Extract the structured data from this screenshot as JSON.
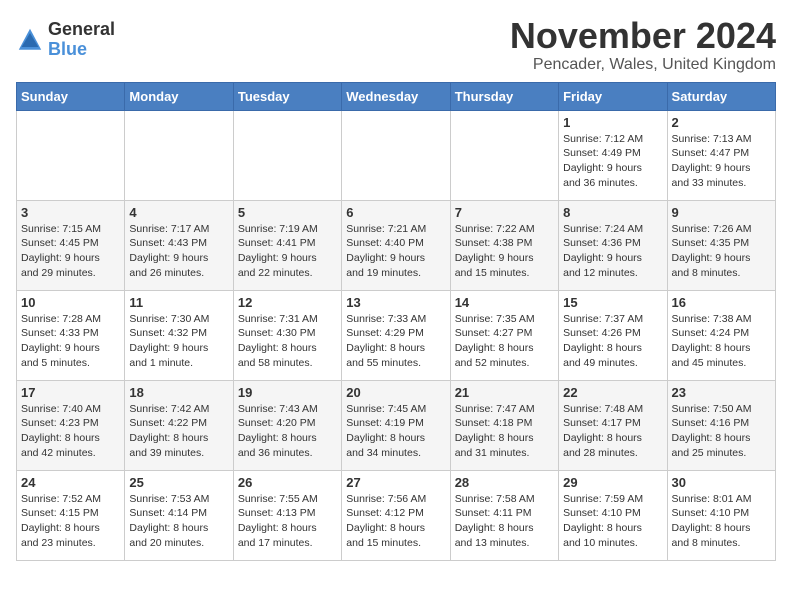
{
  "logo": {
    "general": "General",
    "blue": "Blue"
  },
  "title": "November 2024",
  "subtitle": "Pencader, Wales, United Kingdom",
  "days_of_week": [
    "Sunday",
    "Monday",
    "Tuesday",
    "Wednesday",
    "Thursday",
    "Friday",
    "Saturday"
  ],
  "weeks": [
    [
      {
        "day": "",
        "info": ""
      },
      {
        "day": "",
        "info": ""
      },
      {
        "day": "",
        "info": ""
      },
      {
        "day": "",
        "info": ""
      },
      {
        "day": "",
        "info": ""
      },
      {
        "day": "1",
        "info": "Sunrise: 7:12 AM\nSunset: 4:49 PM\nDaylight: 9 hours\nand 36 minutes."
      },
      {
        "day": "2",
        "info": "Sunrise: 7:13 AM\nSunset: 4:47 PM\nDaylight: 9 hours\nand 33 minutes."
      }
    ],
    [
      {
        "day": "3",
        "info": "Sunrise: 7:15 AM\nSunset: 4:45 PM\nDaylight: 9 hours\nand 29 minutes."
      },
      {
        "day": "4",
        "info": "Sunrise: 7:17 AM\nSunset: 4:43 PM\nDaylight: 9 hours\nand 26 minutes."
      },
      {
        "day": "5",
        "info": "Sunrise: 7:19 AM\nSunset: 4:41 PM\nDaylight: 9 hours\nand 22 minutes."
      },
      {
        "day": "6",
        "info": "Sunrise: 7:21 AM\nSunset: 4:40 PM\nDaylight: 9 hours\nand 19 minutes."
      },
      {
        "day": "7",
        "info": "Sunrise: 7:22 AM\nSunset: 4:38 PM\nDaylight: 9 hours\nand 15 minutes."
      },
      {
        "day": "8",
        "info": "Sunrise: 7:24 AM\nSunset: 4:36 PM\nDaylight: 9 hours\nand 12 minutes."
      },
      {
        "day": "9",
        "info": "Sunrise: 7:26 AM\nSunset: 4:35 PM\nDaylight: 9 hours\nand 8 minutes."
      }
    ],
    [
      {
        "day": "10",
        "info": "Sunrise: 7:28 AM\nSunset: 4:33 PM\nDaylight: 9 hours\nand 5 minutes."
      },
      {
        "day": "11",
        "info": "Sunrise: 7:30 AM\nSunset: 4:32 PM\nDaylight: 9 hours\nand 1 minute."
      },
      {
        "day": "12",
        "info": "Sunrise: 7:31 AM\nSunset: 4:30 PM\nDaylight: 8 hours\nand 58 minutes."
      },
      {
        "day": "13",
        "info": "Sunrise: 7:33 AM\nSunset: 4:29 PM\nDaylight: 8 hours\nand 55 minutes."
      },
      {
        "day": "14",
        "info": "Sunrise: 7:35 AM\nSunset: 4:27 PM\nDaylight: 8 hours\nand 52 minutes."
      },
      {
        "day": "15",
        "info": "Sunrise: 7:37 AM\nSunset: 4:26 PM\nDaylight: 8 hours\nand 49 minutes."
      },
      {
        "day": "16",
        "info": "Sunrise: 7:38 AM\nSunset: 4:24 PM\nDaylight: 8 hours\nand 45 minutes."
      }
    ],
    [
      {
        "day": "17",
        "info": "Sunrise: 7:40 AM\nSunset: 4:23 PM\nDaylight: 8 hours\nand 42 minutes."
      },
      {
        "day": "18",
        "info": "Sunrise: 7:42 AM\nSunset: 4:22 PM\nDaylight: 8 hours\nand 39 minutes."
      },
      {
        "day": "19",
        "info": "Sunrise: 7:43 AM\nSunset: 4:20 PM\nDaylight: 8 hours\nand 36 minutes."
      },
      {
        "day": "20",
        "info": "Sunrise: 7:45 AM\nSunset: 4:19 PM\nDaylight: 8 hours\nand 34 minutes."
      },
      {
        "day": "21",
        "info": "Sunrise: 7:47 AM\nSunset: 4:18 PM\nDaylight: 8 hours\nand 31 minutes."
      },
      {
        "day": "22",
        "info": "Sunrise: 7:48 AM\nSunset: 4:17 PM\nDaylight: 8 hours\nand 28 minutes."
      },
      {
        "day": "23",
        "info": "Sunrise: 7:50 AM\nSunset: 4:16 PM\nDaylight: 8 hours\nand 25 minutes."
      }
    ],
    [
      {
        "day": "24",
        "info": "Sunrise: 7:52 AM\nSunset: 4:15 PM\nDaylight: 8 hours\nand 23 minutes."
      },
      {
        "day": "25",
        "info": "Sunrise: 7:53 AM\nSunset: 4:14 PM\nDaylight: 8 hours\nand 20 minutes."
      },
      {
        "day": "26",
        "info": "Sunrise: 7:55 AM\nSunset: 4:13 PM\nDaylight: 8 hours\nand 17 minutes."
      },
      {
        "day": "27",
        "info": "Sunrise: 7:56 AM\nSunset: 4:12 PM\nDaylight: 8 hours\nand 15 minutes."
      },
      {
        "day": "28",
        "info": "Sunrise: 7:58 AM\nSunset: 4:11 PM\nDaylight: 8 hours\nand 13 minutes."
      },
      {
        "day": "29",
        "info": "Sunrise: 7:59 AM\nSunset: 4:10 PM\nDaylight: 8 hours\nand 10 minutes."
      },
      {
        "day": "30",
        "info": "Sunrise: 8:01 AM\nSunset: 4:10 PM\nDaylight: 8 hours\nand 8 minutes."
      }
    ]
  ]
}
